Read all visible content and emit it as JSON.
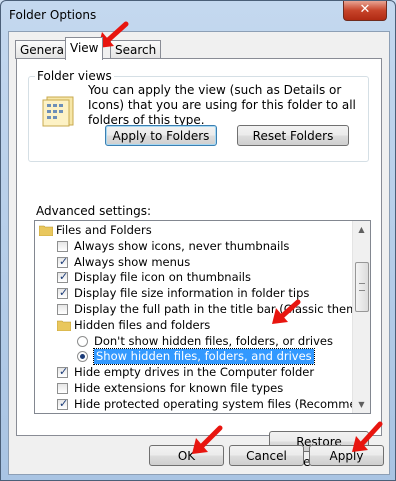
{
  "window": {
    "title": "Folder Options",
    "close_label": "✕"
  },
  "tabs": [
    {
      "label": "General",
      "active": false
    },
    {
      "label": "View",
      "active": true
    },
    {
      "label": "Search",
      "active": false
    }
  ],
  "folder_views": {
    "group_label": "Folder views",
    "description": "You can apply the view (such as Details or Icons) that you are using for this folder to all folders of this type.",
    "apply_button": "Apply to Folders",
    "reset_button": "Reset Folders"
  },
  "advanced": {
    "label": "Advanced settings:",
    "items": [
      {
        "type": "folder",
        "label": "Files and Folders",
        "indent": 0
      },
      {
        "type": "checkbox",
        "label": "Always show icons, never thumbnails",
        "checked": false,
        "indent": 1
      },
      {
        "type": "checkbox",
        "label": "Always show menus",
        "checked": true,
        "indent": 1
      },
      {
        "type": "checkbox",
        "label": "Display file icon on thumbnails",
        "checked": true,
        "indent": 1
      },
      {
        "type": "checkbox",
        "label": "Display file size information in folder tips",
        "checked": true,
        "indent": 1
      },
      {
        "type": "checkbox",
        "label": "Display the full path in the title bar (Classic theme only)",
        "checked": false,
        "indent": 1
      },
      {
        "type": "folder",
        "label": "Hidden files and folders",
        "indent": 1
      },
      {
        "type": "radio",
        "label": "Don't show hidden files, folders, or drives",
        "checked": false,
        "indent": 2
      },
      {
        "type": "radio",
        "label": "Show hidden files, folders, and drives",
        "checked": true,
        "selected": true,
        "indent": 2
      },
      {
        "type": "checkbox",
        "label": "Hide empty drives in the Computer folder",
        "checked": true,
        "indent": 1
      },
      {
        "type": "checkbox",
        "label": "Hide extensions for known file types",
        "checked": false,
        "indent": 1
      },
      {
        "type": "checkbox",
        "label": "Hide protected operating system files (Recommended)",
        "checked": true,
        "indent": 1
      }
    ],
    "restore_button": "Restore Defaults"
  },
  "footer": {
    "ok": "OK",
    "cancel": "Cancel",
    "apply": "Apply"
  },
  "colors": {
    "selection": "#3399ff",
    "annotation_arrow": "#e8150f",
    "check": "#1c3c78"
  },
  "icons": {
    "close": "close-icon",
    "folder": "folder-icon",
    "folder_views": "folder-views-icon"
  }
}
